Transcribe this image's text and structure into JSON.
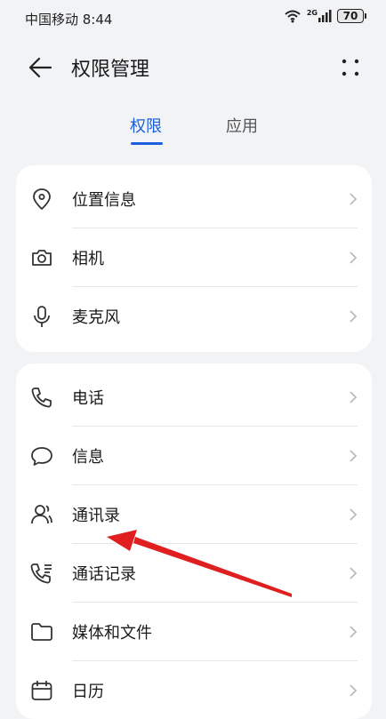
{
  "status_bar": {
    "carrier_time": "中国移动 8:44",
    "network": "2G",
    "battery": "70"
  },
  "header": {
    "title": "权限管理",
    "back_icon": "arrow-left-icon",
    "more_icon": "more-dots-icon"
  },
  "tabs": [
    {
      "label": "权限",
      "active": true
    },
    {
      "label": "应用",
      "active": false
    }
  ],
  "group1": [
    {
      "label": "位置信息",
      "icon": "location-pin-icon"
    },
    {
      "label": "相机",
      "icon": "camera-icon"
    },
    {
      "label": "麦克风",
      "icon": "microphone-icon"
    }
  ],
  "group2": [
    {
      "label": "电话",
      "icon": "phone-icon"
    },
    {
      "label": "信息",
      "icon": "message-icon"
    },
    {
      "label": "通讯录",
      "icon": "contacts-icon"
    },
    {
      "label": "通话记录",
      "icon": "call-log-icon"
    },
    {
      "label": "媒体和文件",
      "icon": "folder-icon"
    },
    {
      "label": "日历",
      "icon": "calendar-icon"
    }
  ],
  "colors": {
    "accent": "#1a5fe0",
    "background": "#f1f3f5",
    "annotation_arrow": "#e02020"
  }
}
